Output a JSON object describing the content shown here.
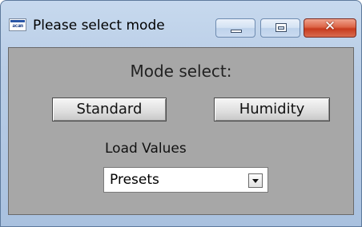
{
  "window": {
    "title": "Please select mode",
    "app_icon_text": "acam",
    "close_glyph": "✕"
  },
  "content": {
    "mode_label": "Mode select:",
    "standard_button": "Standard",
    "humidity_button": "Humidity",
    "load_values_label": "Load Values",
    "load_values_select": {
      "selected": "Presets"
    }
  },
  "icons": [
    "app-icon",
    "minimize-icon",
    "maximize-icon",
    "close-icon",
    "chevron-down-icon"
  ],
  "colors": {
    "client_background": "#a7a7a7",
    "close_button": "#c73b1e",
    "titlebar": "#b9cde6"
  }
}
